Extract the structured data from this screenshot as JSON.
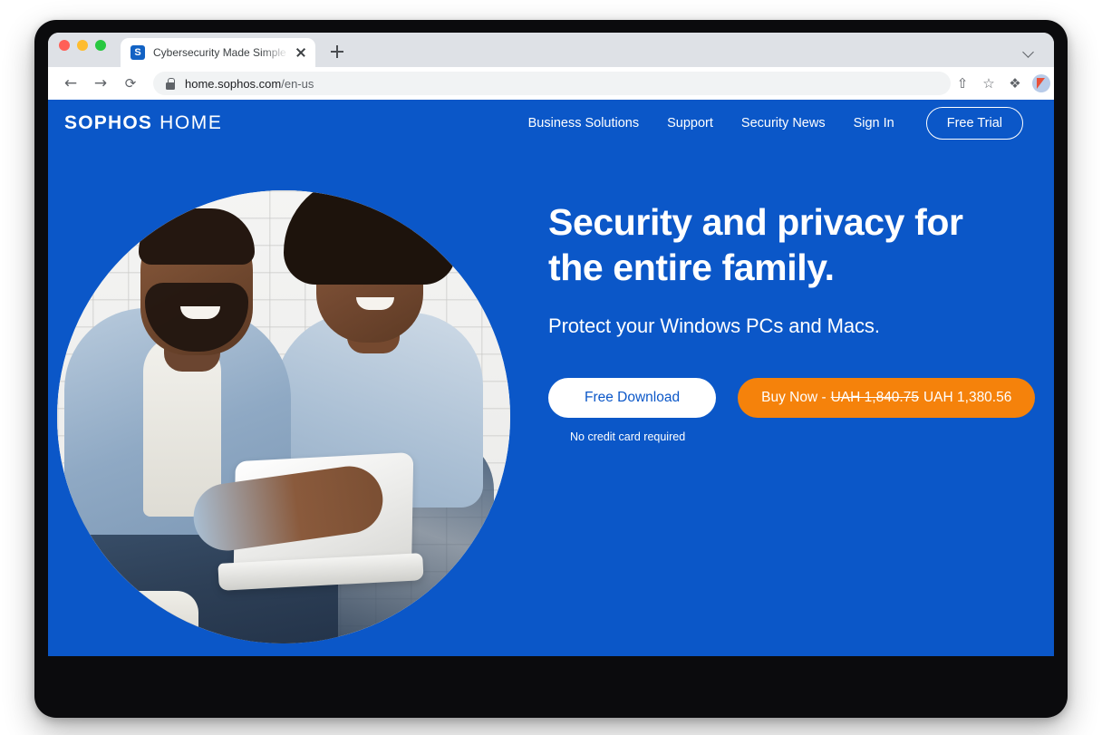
{
  "browser": {
    "traffic_lights": [
      "close",
      "minimize",
      "maximize"
    ],
    "tab": {
      "favicon_letter": "S",
      "title": "Cybersecurity Made Simple | S",
      "close_icon": "close-icon"
    },
    "new_tab_label": "+",
    "tabstrip_chevron": "chevron-down-icon",
    "toolbar": {
      "back_glyph": "←",
      "forward_glyph": "→",
      "reload_glyph": "⟳",
      "lock_icon": "lock-icon",
      "url_domain": "home.sophos.com",
      "url_path": "/en-us",
      "share_glyph": "⇧",
      "bookmark_glyph": "☆",
      "extensions_glyph": "❖",
      "avatar_icon": "profile-avatar",
      "menu_icon": "three-dots-menu-icon"
    }
  },
  "site": {
    "brand": {
      "name": "SOPHOS",
      "product": "HOME"
    },
    "nav": [
      {
        "label": "Business Solutions"
      },
      {
        "label": "Support"
      },
      {
        "label": "Security News"
      },
      {
        "label": "Sign In"
      }
    ],
    "free_trial_label": "Free Trial",
    "hero": {
      "headline_line1": "Security and privacy for",
      "headline_line2": "the entire family.",
      "subheadline": "Protect your Windows PCs and Macs.",
      "primary_cta": "Free Download",
      "buy_now_prefix": "Buy Now -",
      "buy_now_old_price": "UAH 1,840.75",
      "buy_now_new_price": "UAH 1,380.56",
      "note": "No credit card required",
      "image_alt": "couple-with-laptop-photo"
    }
  },
  "colors": {
    "brand_blue": "#0b57c8",
    "cta_orange": "#f5820b",
    "white": "#ffffff",
    "chrome_tabstrip": "#dee1e6",
    "omnibox_bg": "#f1f3f4"
  }
}
